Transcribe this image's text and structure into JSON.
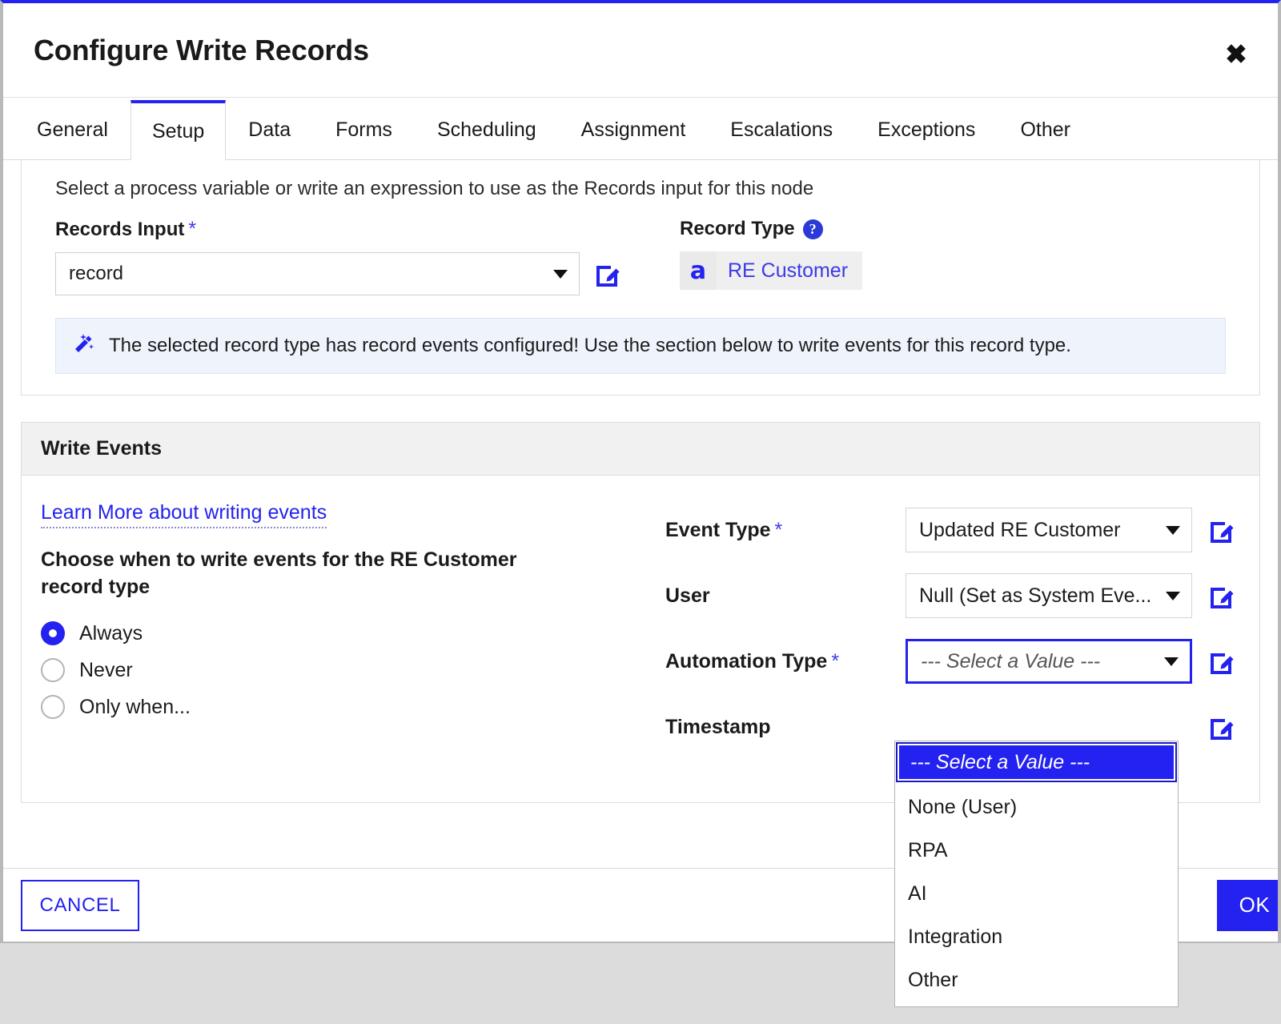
{
  "dialog": {
    "title": "Configure Write Records",
    "close_label": "✖"
  },
  "tabs": [
    {
      "label": "General",
      "active": false
    },
    {
      "label": "Setup",
      "active": true
    },
    {
      "label": "Data",
      "active": false
    },
    {
      "label": "Forms",
      "active": false
    },
    {
      "label": "Scheduling",
      "active": false
    },
    {
      "label": "Assignment",
      "active": false
    },
    {
      "label": "Escalations",
      "active": false
    },
    {
      "label": "Exceptions",
      "active": false
    },
    {
      "label": "Other",
      "active": false
    }
  ],
  "setup": {
    "helper_text": "Select a process variable or write an expression to use as the Records input for this node",
    "records_input": {
      "label": "Records Input",
      "required_marker": "*",
      "value": "record",
      "edit_icon": "edit-pencil-icon"
    },
    "record_type": {
      "label": "Record Type",
      "help_icon": "?",
      "chip_glyph": "a",
      "chip_name": "RE Customer"
    },
    "info_banner": {
      "icon": "magic-wand-icon",
      "text": "The selected record type has record events configured! Use the section below to write events for this record type."
    }
  },
  "write_events": {
    "section_title": "Write Events",
    "learn_more_link": "Learn More about writing events",
    "choose_label": "Choose when to write events for the RE Customer record type",
    "radios": [
      {
        "label": "Always",
        "checked": true
      },
      {
        "label": "Never",
        "checked": false
      },
      {
        "label": "Only when...",
        "checked": false
      }
    ],
    "fields": [
      {
        "label": "Event Type",
        "required": "*",
        "value": "Updated RE Customer",
        "placeholder": false,
        "focused": false
      },
      {
        "label": "User",
        "required": "",
        "value": "Null (Set as System Eve...",
        "placeholder": false,
        "focused": false
      },
      {
        "label": "Automation Type",
        "required": "*",
        "value": "--- Select a Value ---",
        "placeholder": true,
        "focused": true
      },
      {
        "label": "Timestamp",
        "required": "",
        "value": "",
        "placeholder": false,
        "focused": false
      }
    ],
    "automation_dropdown": {
      "options": [
        {
          "label": "--- Select a Value ---",
          "selected": true
        },
        {
          "label": "None (User)",
          "selected": false
        },
        {
          "label": "RPA",
          "selected": false
        },
        {
          "label": "AI",
          "selected": false
        },
        {
          "label": "Integration",
          "selected": false
        },
        {
          "label": "Other",
          "selected": false
        }
      ]
    }
  },
  "footer": {
    "cancel_label": "CANCEL",
    "ok_label": "OK"
  },
  "colors": {
    "accent": "#2322f0",
    "banner_bg": "#eef3fc",
    "section_header_bg": "#f1f1f1"
  }
}
